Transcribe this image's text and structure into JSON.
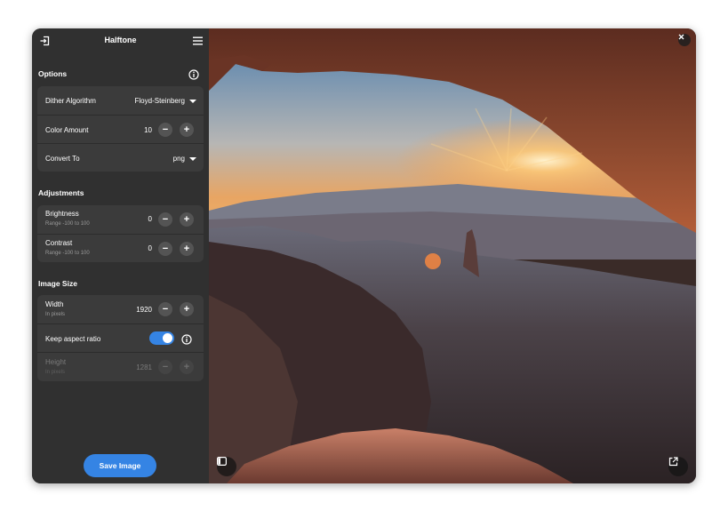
{
  "window": {
    "title": "Halftone"
  },
  "options": {
    "title": "Options",
    "dither": {
      "label": "Dither Algorithm",
      "value": "Floyd-Steinberg"
    },
    "color": {
      "label": "Color Amount",
      "value": "10",
      "minus": "−",
      "plus": "+"
    },
    "convert": {
      "label": "Convert To",
      "value": "png"
    }
  },
  "adjustments": {
    "title": "Adjustments",
    "brightness": {
      "label": "Brightness",
      "sub": "Range -100 to 100",
      "value": "0"
    },
    "contrast": {
      "label": "Contrast",
      "sub": "Range -100 to 100",
      "value": "0"
    }
  },
  "image_size": {
    "title": "Image Size",
    "width": {
      "label": "Width",
      "sub": "In pixels",
      "value": "1920"
    },
    "aspect": {
      "label": "Keep aspect ratio",
      "on": true
    },
    "height": {
      "label": "Height",
      "sub": "In pixels",
      "value": "1281"
    }
  },
  "save_label": "Save Image",
  "icons": {
    "open": "open-file-icon",
    "menu": "hamburger-menu-icon",
    "info": "info-icon",
    "sidebar": "sidebar-toggle-icon",
    "external": "open-external-icon",
    "close": "close-icon"
  },
  "colors": {
    "accent": "#3584e4",
    "sidebar_bg": "#303030",
    "row_bg": "#3b3b3b"
  }
}
